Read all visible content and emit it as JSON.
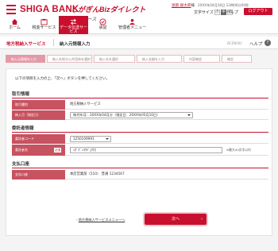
{
  "header": {
    "bank_name": "SHIGA BANK",
    "service_name": "しがぎんBizダイレクト",
    "service_sub": "Lightコース",
    "user_name": "滋賀 銀太郎",
    "user_suffix": "様",
    "last_login": "20XX年04月18日 12時00分00秒",
    "font_size_label": "文字サイズ",
    "font_size_options": [
      "小",
      "中",
      "大"
    ],
    "help_label": "ヘルプ",
    "logout_label": "ログアウト"
  },
  "gnav": [
    {
      "label": "ホーム"
    },
    {
      "label": "税金サービス"
    },
    {
      "label": "データ伝送サービス"
    },
    {
      "label": "承認"
    },
    {
      "label": "管理者メニュー"
    }
  ],
  "titlebar": {
    "service": "地方税納入サービス",
    "page": "納入元情報入力",
    "screen_code": "BCZN002",
    "help": "ヘルプ",
    "help_icon": "?"
  },
  "steps": [
    {
      "label": "納入元情報を入力"
    },
    {
      "label": "納入先地方公共団体を選択"
    },
    {
      "label": "納入先を選択"
    },
    {
      "label": "納入金額を入力"
    },
    {
      "label": "内容確認"
    },
    {
      "label": "確定"
    }
  ],
  "intro": "以下の項目を入力の上、「次へ」ボタンを押してください。",
  "sections": {
    "transaction": {
      "title": "取引情報",
      "rows": [
        {
          "label": "取引種別",
          "value": "地方税納入サービス"
        },
        {
          "label": "納入月（指定日）",
          "value": "納付年月：20XX年04月分（指定日：20XX年05月10日）"
        }
      ]
    },
    "consignor": {
      "title": "委託者情報",
      "rows": [
        {
          "label": "委託者コード",
          "value": "1250109991"
        },
        {
          "label": "委託者名",
          "required": "必須",
          "value": "ｼｶﾞｷﾞﾝｺｳｷﾞｮｳ(ｶ",
          "hint": "※最大40文字以内"
        }
      ]
    },
    "payment": {
      "title": "支払口座",
      "rows": [
        {
          "label": "支払口座",
          "value": "本店営業部（510） 普通 1234567"
        }
      ]
    }
  },
  "footer": {
    "back_label": "地方税納入サービスメニューへ",
    "next_label": "次へ"
  },
  "colors": {
    "brand": "#c8102e",
    "label_bg": "#c75260",
    "step_active": "#e49aa6"
  }
}
